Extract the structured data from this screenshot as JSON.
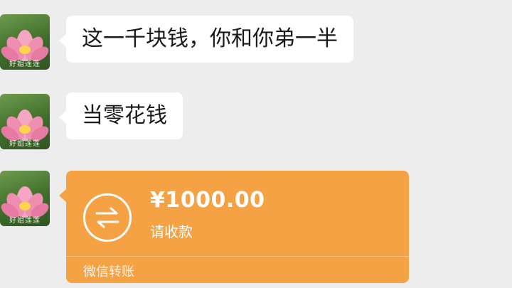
{
  "avatar": {
    "caption": "好姐莲莲",
    "icon": "lotus-avatar-icon"
  },
  "messages": [
    {
      "type": "text",
      "text": "这一千块钱，你和你弟一半"
    },
    {
      "type": "text",
      "text": "当零花钱"
    }
  ],
  "transfer": {
    "amount": "¥1000.00",
    "status": "请收款",
    "footer": "微信转账",
    "icon": "transfer-arrows-icon",
    "color": "#f5a245"
  }
}
